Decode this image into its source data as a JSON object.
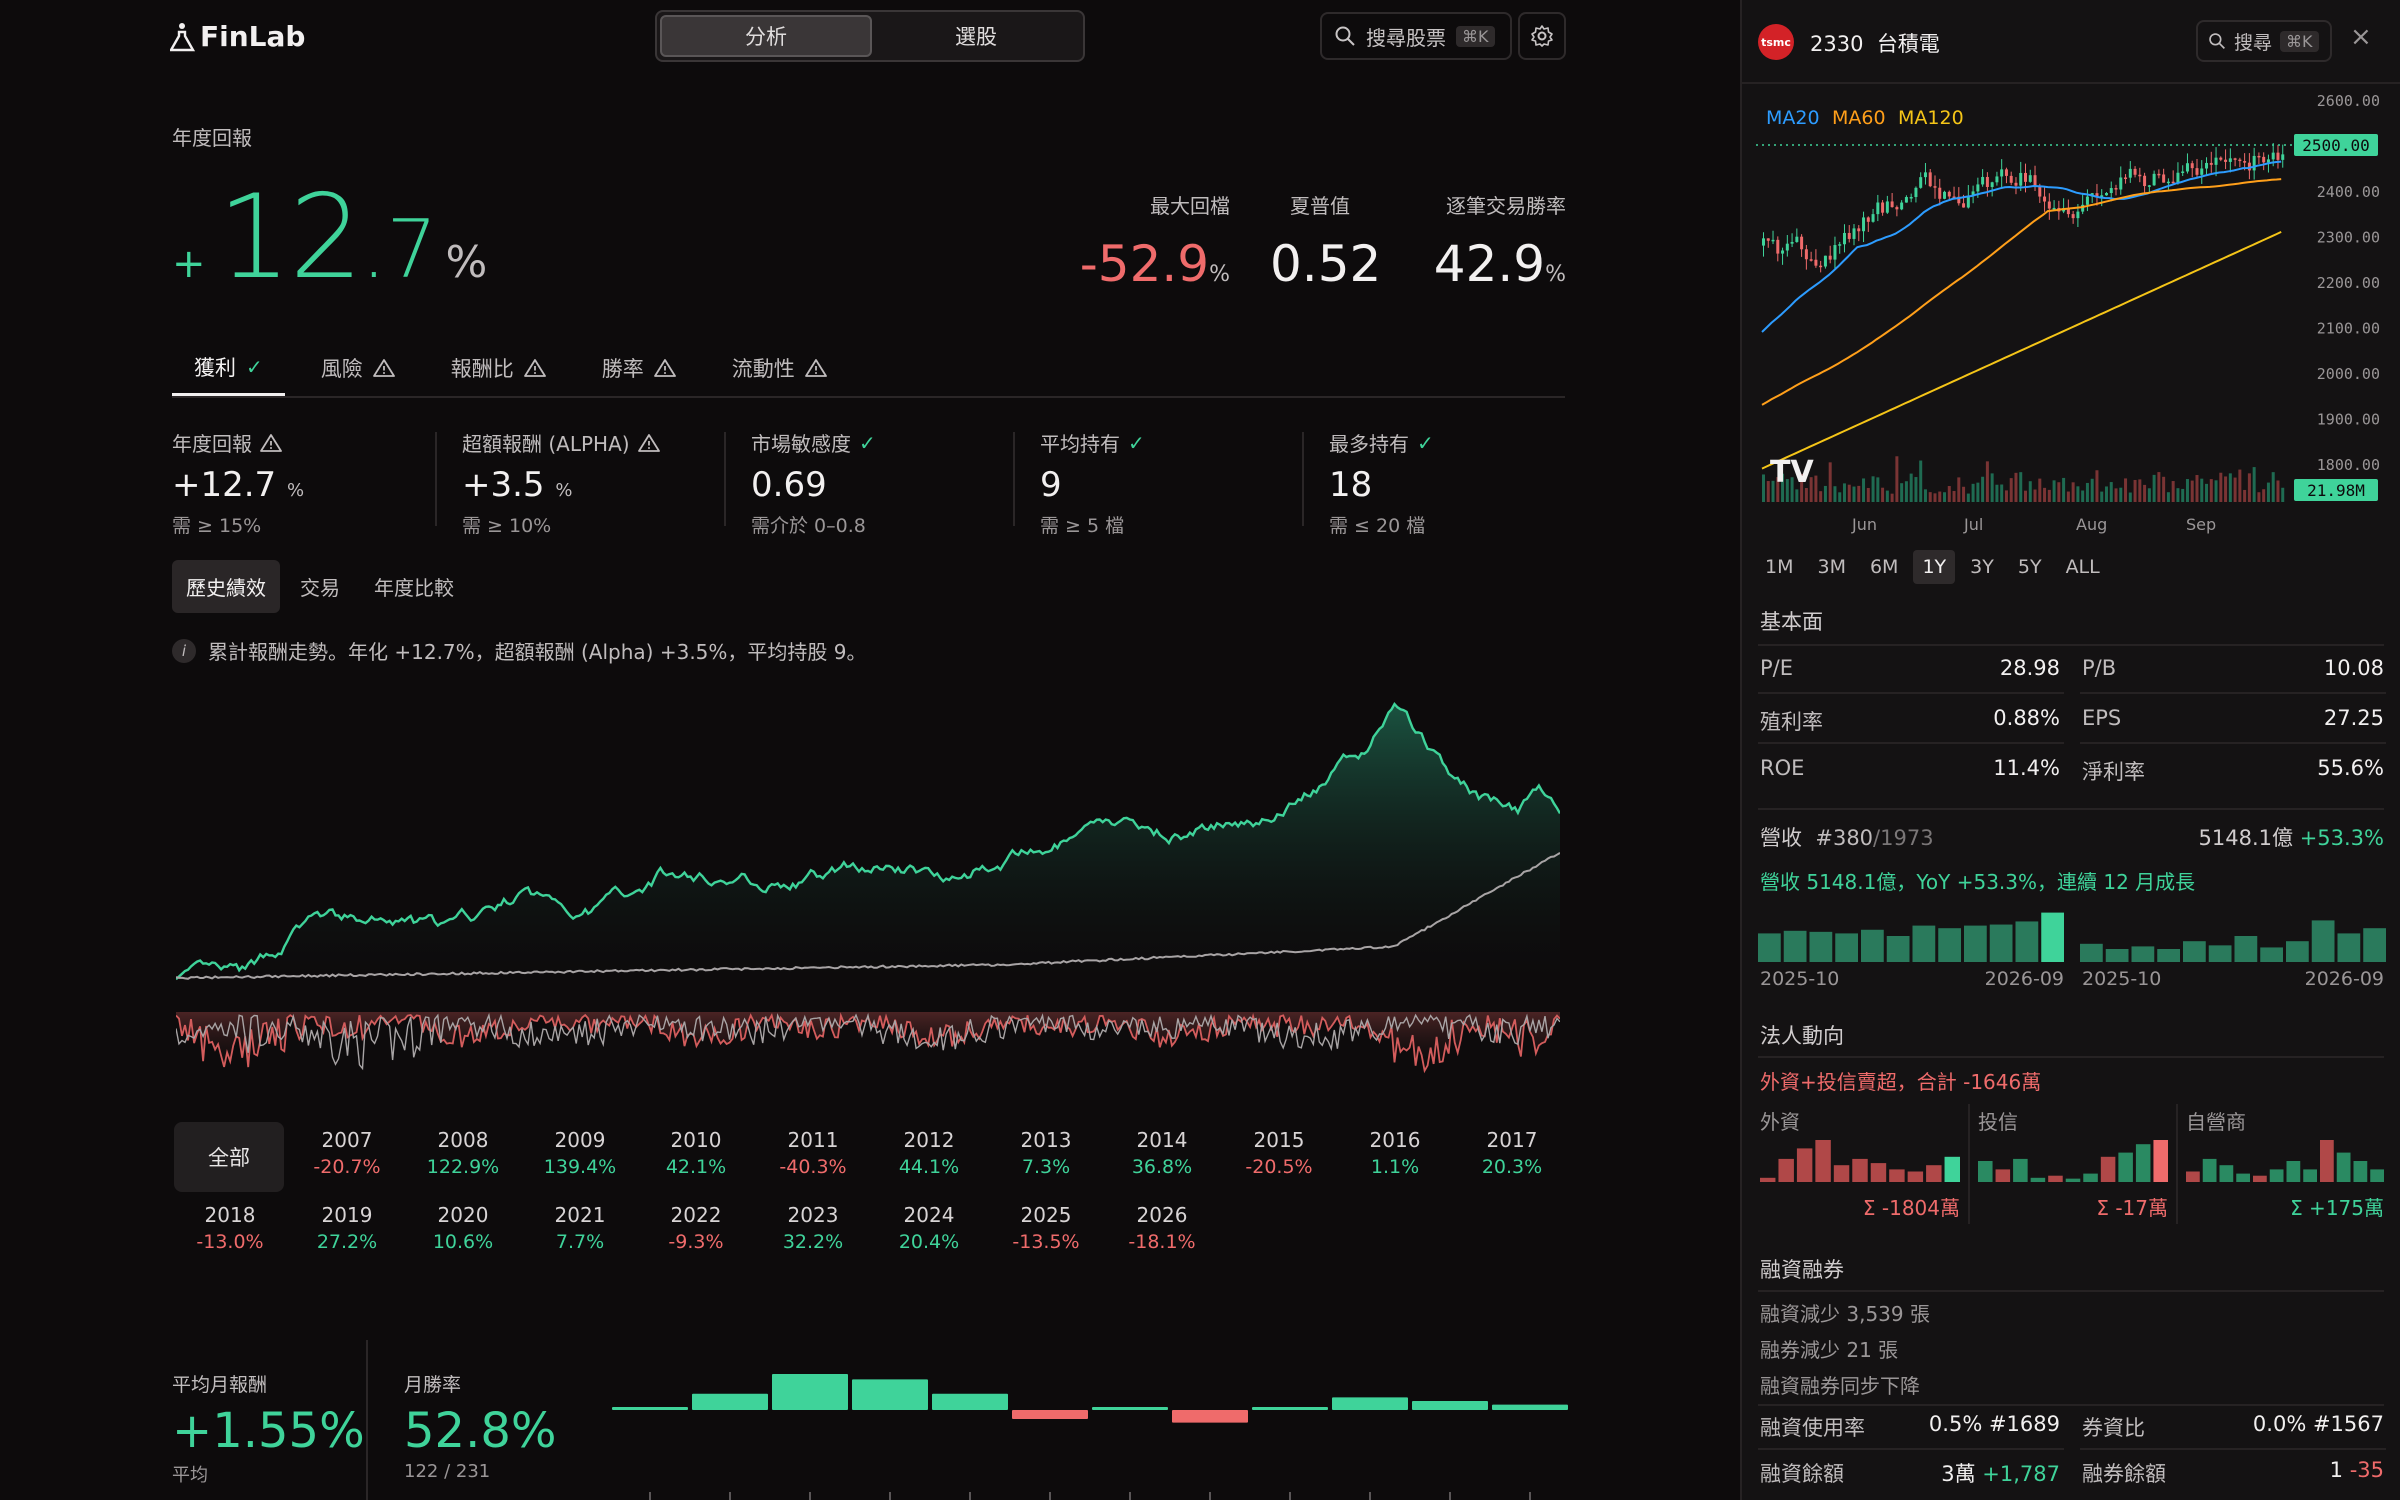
{
  "header": {
    "logo": "FinLab",
    "seg_options": [
      "分析",
      "選股"
    ],
    "search_label": "搜尋股票",
    "search_kbd": "⌘K"
  },
  "summary": {
    "title": "年度回報",
    "sign": "+",
    "int": "12",
    "dec": ".7",
    "pct": "%",
    "kpis": [
      {
        "label": "最大回檔",
        "value": "-52.9",
        "unit": "%",
        "color": "#ef6b6b"
      },
      {
        "label": "夏普值",
        "value": "0.52",
        "unit": "",
        "color": "#f2f0f0"
      },
      {
        "label": "逐筆交易勝率",
        "value": "42.9",
        "unit": "%",
        "color": "#f2f0f0"
      }
    ]
  },
  "tabs": [
    {
      "label": "獲利",
      "status": "check"
    },
    {
      "label": "風險",
      "status": "warn"
    },
    {
      "label": "報酬比",
      "status": "warn"
    },
    {
      "label": "勝率",
      "status": "warn"
    },
    {
      "label": "流動性",
      "status": "warn"
    }
  ],
  "metrics": [
    {
      "title": "年度回報",
      "status": "warn",
      "value": "+12.7",
      "unit": "%",
      "req": "需 ≥ 15%"
    },
    {
      "title": "超額報酬 (ALPHA)",
      "status": "warn",
      "value": "+3.5",
      "unit": "%",
      "req": "需 ≥ 10%"
    },
    {
      "title": "市場敏感度",
      "status": "check",
      "value": "0.69",
      "unit": "",
      "req": "需介於 0–0.8"
    },
    {
      "title": "平均持有",
      "status": "check",
      "value": "9",
      "unit": "",
      "req": "需 ≥ 5 檔"
    },
    {
      "title": "最多持有",
      "status": "check",
      "value": "18",
      "unit": "",
      "req": "需 ≤ 20 檔"
    }
  ],
  "subtabs": [
    "歷史績效",
    "交易",
    "年度比較"
  ],
  "info_text": "累計報酬走勢。年化 +12.7%，超額報酬 (Alpha) +3.5%，平均持股 9。",
  "years": {
    "all_label": "全部",
    "items": [
      {
        "year": "2007",
        "ret": "-20.7%"
      },
      {
        "year": "2008",
        "ret": "122.9%"
      },
      {
        "year": "2009",
        "ret": "139.4%"
      },
      {
        "year": "2010",
        "ret": "42.1%"
      },
      {
        "year": "2011",
        "ret": "-40.3%"
      },
      {
        "year": "2012",
        "ret": "44.1%"
      },
      {
        "year": "2013",
        "ret": "7.3%"
      },
      {
        "year": "2014",
        "ret": "36.8%"
      },
      {
        "year": "2015",
        "ret": "-20.5%"
      },
      {
        "year": "2016",
        "ret": "1.1%"
      },
      {
        "year": "2017",
        "ret": "20.3%"
      },
      {
        "year": "2018",
        "ret": "-13.0%"
      },
      {
        "year": "2019",
        "ret": "27.2%"
      },
      {
        "year": "2020",
        "ret": "10.6%"
      },
      {
        "year": "2021",
        "ret": "7.7%"
      },
      {
        "year": "2022",
        "ret": "-9.3%"
      },
      {
        "year": "2023",
        "ret": "32.2%"
      },
      {
        "year": "2024",
        "ret": "20.4%"
      },
      {
        "year": "2025",
        "ret": "-13.5%"
      },
      {
        "year": "2026",
        "ret": "-18.1%"
      }
    ]
  },
  "bottom": {
    "avg_monthly_label": "平均月報酬",
    "avg_monthly_value": "+1.55%",
    "avg_monthly_sub": "平均",
    "win_rate_label": "月勝率",
    "win_rate_value": "52.8%",
    "win_rate_sub": "122 / 231",
    "monthly_bars": [
      0.05,
      0.45,
      1.0,
      0.85,
      0.45,
      -0.25,
      0.08,
      -0.35,
      0.08,
      0.35,
      0.25,
      0.15
    ]
  },
  "stock": {
    "logo_text": "tsmc",
    "code": "2330",
    "name": "台積電",
    "search_label": "搜尋",
    "search_kbd": "⌘K",
    "close_icon": "close-icon",
    "ma_labels": [
      {
        "name": "MA20",
        "color": "#2d9cff"
      },
      {
        "name": "MA60",
        "color": "#ff9f1a"
      },
      {
        "name": "MA120",
        "color": "#f5c518"
      }
    ],
    "price_ticks": [
      "2600.00",
      "2500.00",
      "2400.00",
      "2300.00",
      "2200.00",
      "2100.00",
      "2000.00",
      "1900.00",
      "1800.00"
    ],
    "price_tag": "2500.00",
    "vol_tag": "21.98M",
    "months": [
      "Jun",
      "Jul",
      "Aug",
      "Sep"
    ],
    "ranges": [
      "1M",
      "3M",
      "6M",
      "1Y",
      "3Y",
      "5Y",
      "ALL"
    ],
    "active_range": "1Y"
  },
  "fundamentals": {
    "title": "基本面",
    "rows": [
      [
        {
          "k": "P/E",
          "v": "28.98"
        },
        {
          "k": "P/B",
          "v": "10.08"
        }
      ],
      [
        {
          "k": "殖利率",
          "v": "0.88%"
        },
        {
          "k": "EPS",
          "v": "27.25"
        }
      ],
      [
        {
          "k": "ROE",
          "v": "11.4%"
        },
        {
          "k": "淨利率",
          "v": "55.6%"
        }
      ]
    ]
  },
  "revenue": {
    "title": "營收",
    "rank": "#380",
    "rank_total": "/1973",
    "amount": "5148.1億",
    "yoy": "+53.3%",
    "desc": "營收 5148.1億，YoY +53.3%，連續 12 月成長",
    "left_start": "2025-10",
    "left_end": "2026-09",
    "right_start": "2025-10",
    "right_end": "2026-09",
    "left_bars": [
      0.55,
      0.6,
      0.58,
      0.55,
      0.62,
      0.5,
      0.7,
      0.65,
      0.7,
      0.72,
      0.78,
      0.95
    ],
    "right_bars": [
      0.35,
      0.25,
      0.3,
      0.25,
      0.4,
      0.32,
      0.5,
      0.28,
      0.4,
      0.8,
      0.55,
      0.65
    ]
  },
  "institutional": {
    "title": "法人動向",
    "summary": "外資+投信賣超，合計 -1646萬",
    "groups": [
      {
        "name": "外資",
        "sum": "Σ -1804萬",
        "bars": [
          0.1,
          0.55,
          0.8,
          1.0,
          0.4,
          0.55,
          0.45,
          0.3,
          0.25,
          0.4,
          0.6
        ]
      },
      {
        "name": "投信",
        "sum": "Σ -17萬",
        "bars": [
          0.5,
          0.3,
          0.55,
          0.1,
          0.15,
          0.08,
          0.2,
          0.6,
          0.7,
          0.9,
          1.0
        ]
      },
      {
        "name": "自營商",
        "sum": "Σ +175萬",
        "bars": [
          0.25,
          0.55,
          0.4,
          0.2,
          0.15,
          0.3,
          0.5,
          0.3,
          1.0,
          0.7,
          0.5,
          0.3
        ]
      }
    ]
  },
  "margin": {
    "title": "融資融券",
    "lines": [
      "融資減少 3,539 張",
      "融券減少 21 張",
      "融資融券同步下降"
    ],
    "rows": [
      [
        {
          "k": "融資使用率",
          "v": "0.5% #1689"
        },
        {
          "k": "券資比",
          "v": "0.0% #1567"
        }
      ],
      [
        {
          "k": "融資餘額",
          "v": "3萬",
          "d": "+1,787"
        },
        {
          "k": "融券餘額",
          "v": "1",
          "d": "-35"
        }
      ]
    ]
  },
  "colors": {
    "green": "#3fd39a",
    "red": "#ef6b6b",
    "bg": "#0d0b0c",
    "panel": "#141213"
  }
}
